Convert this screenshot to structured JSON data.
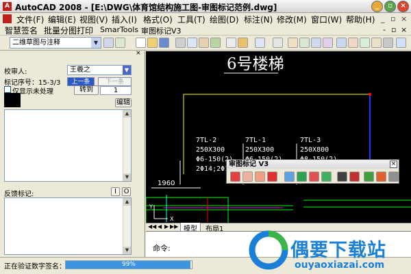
{
  "window": {
    "app_icon": "A",
    "title": "AutoCAD 2008 - [E:\\DWG\\体育馆结构施工图-审图标记范例.dwg]"
  },
  "menu": {
    "items": [
      "文件(F)",
      "编辑(E)",
      "视图(V)",
      "插入(I)",
      "格式(O)",
      "工具(T)",
      "绘图(D)",
      "标注(N)",
      "修改(M)",
      "窗口(W)",
      "帮助(H)"
    ],
    "doc_controls": [
      "_",
      "▫",
      "×"
    ]
  },
  "submenu": {
    "items": [
      "智慧签名",
      "批量分图打印",
      "SmarTools",
      "审图标记V3"
    ],
    "doc_controls": [
      "-",
      "▫",
      "×"
    ]
  },
  "toolbar": {
    "layer_value": "二维草图与注释"
  },
  "panel": {
    "reviewer_label": "校审人:",
    "reviewer_value": "王羲之",
    "prev_button": "上一条",
    "next_button": "下一条",
    "seq_label": "标记序号：15-3/3",
    "goto_button": "转到",
    "goto_value": "1",
    "show_unprocessed_label": "仅显示未处理",
    "edit_button": "编辑",
    "feedback_label": "反馈标记:",
    "btn_i": "I",
    "btn_o": "O"
  },
  "drawing": {
    "title": "6号楼梯",
    "dim": "1960",
    "beams": [
      {
        "name": "7TL-2",
        "size": "250X300",
        "line3": "Φ6-150(2)",
        "line4": "2Φ14;2Φ1"
      },
      {
        "name": "7TL-1",
        "size": "250X300",
        "line3": "Φ6-150(2)",
        "line4": ""
      },
      {
        "name": "7TL-3",
        "size": "250X800",
        "line3": "Φ8-150(2)",
        "line4": ""
      }
    ],
    "axis_y": "Y",
    "axis_x": "X"
  },
  "tabs": {
    "model": "模型",
    "layout": "布局1"
  },
  "command": {
    "prompt": "命令:"
  },
  "status": {
    "text": "正在验证数字签名：",
    "progress_percent": 99,
    "progress_text": "99%"
  },
  "floating": {
    "title": "审图标记 V3",
    "close": "×"
  },
  "watermark": {
    "title": "偶要下载站",
    "url": "ouyaoxiazai.com"
  }
}
